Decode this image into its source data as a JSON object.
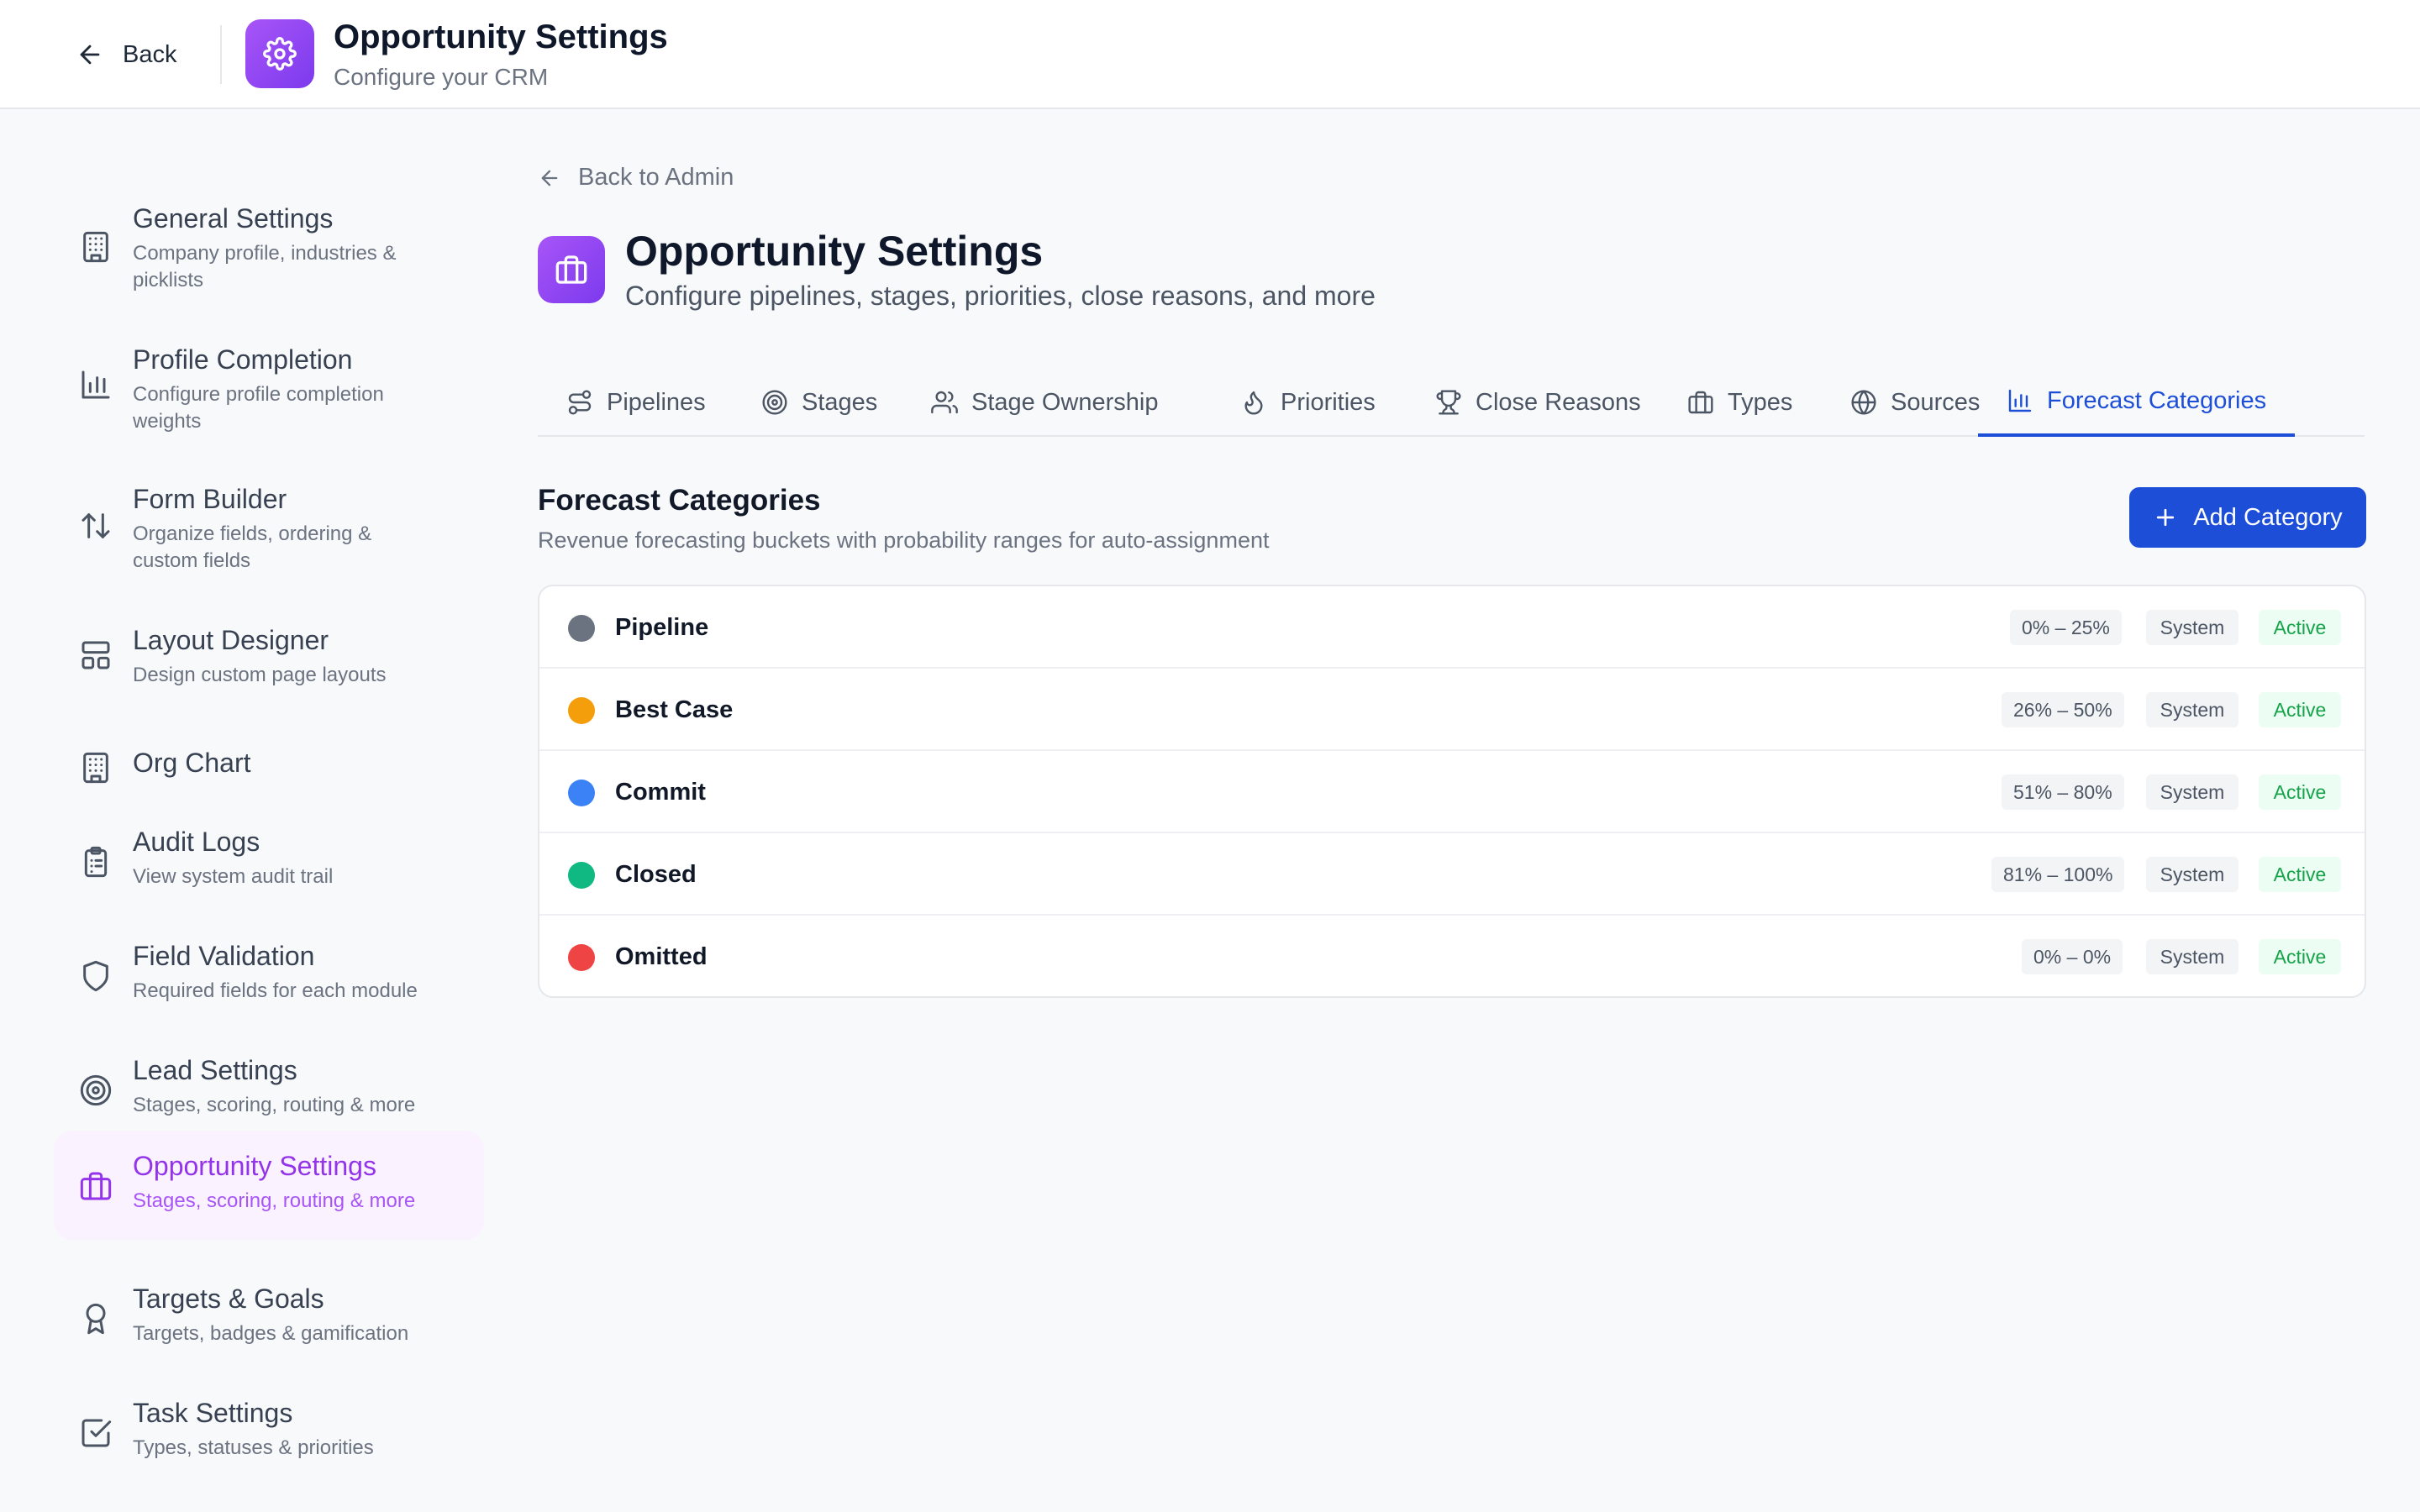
{
  "header": {
    "back_label": "Back",
    "title": "Opportunity Settings",
    "subtitle": "Configure your CRM"
  },
  "sidebar": {
    "items": [
      {
        "title": "General Settings",
        "desc": "Company profile, industries & picklists",
        "icon": "building-icon"
      },
      {
        "title": "Profile Completion",
        "desc": "Configure profile completion weights",
        "icon": "bar-chart-icon"
      },
      {
        "title": "Form Builder",
        "desc": "Organize fields, ordering & custom fields",
        "icon": "sort-arrows-icon"
      },
      {
        "title": "Layout Designer",
        "desc": "Design custom page layouts",
        "icon": "layout-icon"
      },
      {
        "title": "Org Chart",
        "desc": "",
        "icon": "building-icon"
      },
      {
        "title": "Audit Logs",
        "desc": "View system audit trail",
        "icon": "clipboard-icon"
      },
      {
        "title": "Field Validation",
        "desc": "Required fields for each module",
        "icon": "shield-icon"
      },
      {
        "title": "Lead Settings",
        "desc": "Stages, scoring, routing & more",
        "icon": "target-icon"
      },
      {
        "title": "Opportunity Settings",
        "desc": "Stages, scoring, routing & more",
        "icon": "briefcase-icon",
        "active": true
      },
      {
        "title": "Targets & Goals",
        "desc": "Targets, badges & gamification",
        "icon": "award-icon"
      },
      {
        "title": "Task Settings",
        "desc": "Types, statuses & priorities",
        "icon": "check-square-icon"
      }
    ]
  },
  "main": {
    "breadcrumb": "Back to Admin",
    "title": "Opportunity Settings",
    "subtitle": "Configure pipelines, stages, priorities, close reasons, and more",
    "tabs": [
      {
        "label": "Pipelines",
        "icon": "route-icon"
      },
      {
        "label": "Stages",
        "icon": "target-icon"
      },
      {
        "label": "Stage Ownership",
        "icon": "users-icon"
      },
      {
        "label": "Priorities",
        "icon": "flame-icon"
      },
      {
        "label": "Close Reasons",
        "icon": "trophy-icon"
      },
      {
        "label": "Types",
        "icon": "briefcase-icon"
      },
      {
        "label": "Sources",
        "icon": "globe-icon"
      },
      {
        "label": "Forecast Categories",
        "icon": "bar-chart-icon",
        "active": true
      }
    ],
    "section": {
      "title": "Forecast Categories",
      "desc": "Revenue forecasting buckets with probability ranges for auto-assignment",
      "add_label": "Add Category"
    },
    "categories": [
      {
        "name": "Pipeline",
        "color": "#6b7280",
        "range": "0% – 25%",
        "system": "System",
        "status": "Active"
      },
      {
        "name": "Best Case",
        "color": "#f59e0b",
        "range": "26% – 50%",
        "system": "System",
        "status": "Active"
      },
      {
        "name": "Commit",
        "color": "#3b82f6",
        "range": "51% – 80%",
        "system": "System",
        "status": "Active"
      },
      {
        "name": "Closed",
        "color": "#10b981",
        "range": "81% – 100%",
        "system": "System",
        "status": "Active"
      },
      {
        "name": "Omitted",
        "color": "#ef4444",
        "range": "0% – 0%",
        "system": "System",
        "status": "Active"
      }
    ]
  },
  "colors": {
    "accent_blue": "#1d4ed8",
    "accent_purple": "#9333ea",
    "active_green": "#16a34a"
  }
}
